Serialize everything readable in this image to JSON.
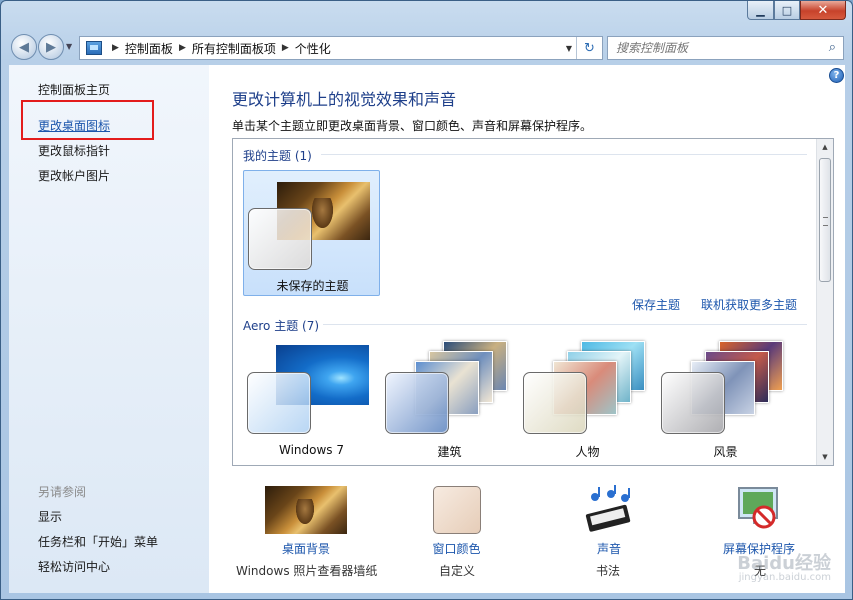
{
  "window": {
    "caption": {
      "minimize": "▁",
      "maximize": "□",
      "close": "✕"
    }
  },
  "nav": {
    "back_icon": "back-arrow-icon",
    "forward_icon": "forward-arrow-icon",
    "crumbs": [
      "控制面板",
      "所有控制面板项",
      "个性化"
    ],
    "search_placeholder": "搜索控制面板"
  },
  "sidebar": {
    "home": "控制面板主页",
    "items": [
      "更改桌面图标",
      "更改鼠标指针",
      "更改帐户图片"
    ],
    "see_also_title": "另请参阅",
    "see_also": [
      "显示",
      "任务栏和「开始」菜单",
      "轻松访问中心"
    ]
  },
  "main": {
    "title": "更改计算机上的视觉效果和声音",
    "subtitle": "单击某个主题立即更改桌面背景、窗口颜色、声音和屏幕保护程序。",
    "my_themes": {
      "title": "我的主题 (1)",
      "items": [
        {
          "label": "未保存的主题"
        }
      ]
    },
    "save_theme": "保存主题",
    "more_themes": "联机获取更多主题",
    "aero_themes": {
      "title": "Aero 主题 (7)",
      "items": [
        {
          "label": "Windows 7"
        },
        {
          "label": "建筑"
        },
        {
          "label": "人物"
        },
        {
          "label": "风景"
        }
      ]
    }
  },
  "bottom": [
    {
      "link": "桌面背景",
      "value": "Windows 照片查看器墙纸"
    },
    {
      "link": "窗口颜色",
      "value": "自定义"
    },
    {
      "link": "声音",
      "value": "书法"
    },
    {
      "link": "屏幕保护程序",
      "value": "无"
    }
  ],
  "watermark": {
    "line1": "Baidu经验",
    "line2": "jingyan.baidu.com"
  },
  "colors": {
    "link": "#1c56ac",
    "title": "#1e3f8a",
    "highlight_box": "#e31c1c",
    "selected_tile": "#c8e0fb"
  }
}
